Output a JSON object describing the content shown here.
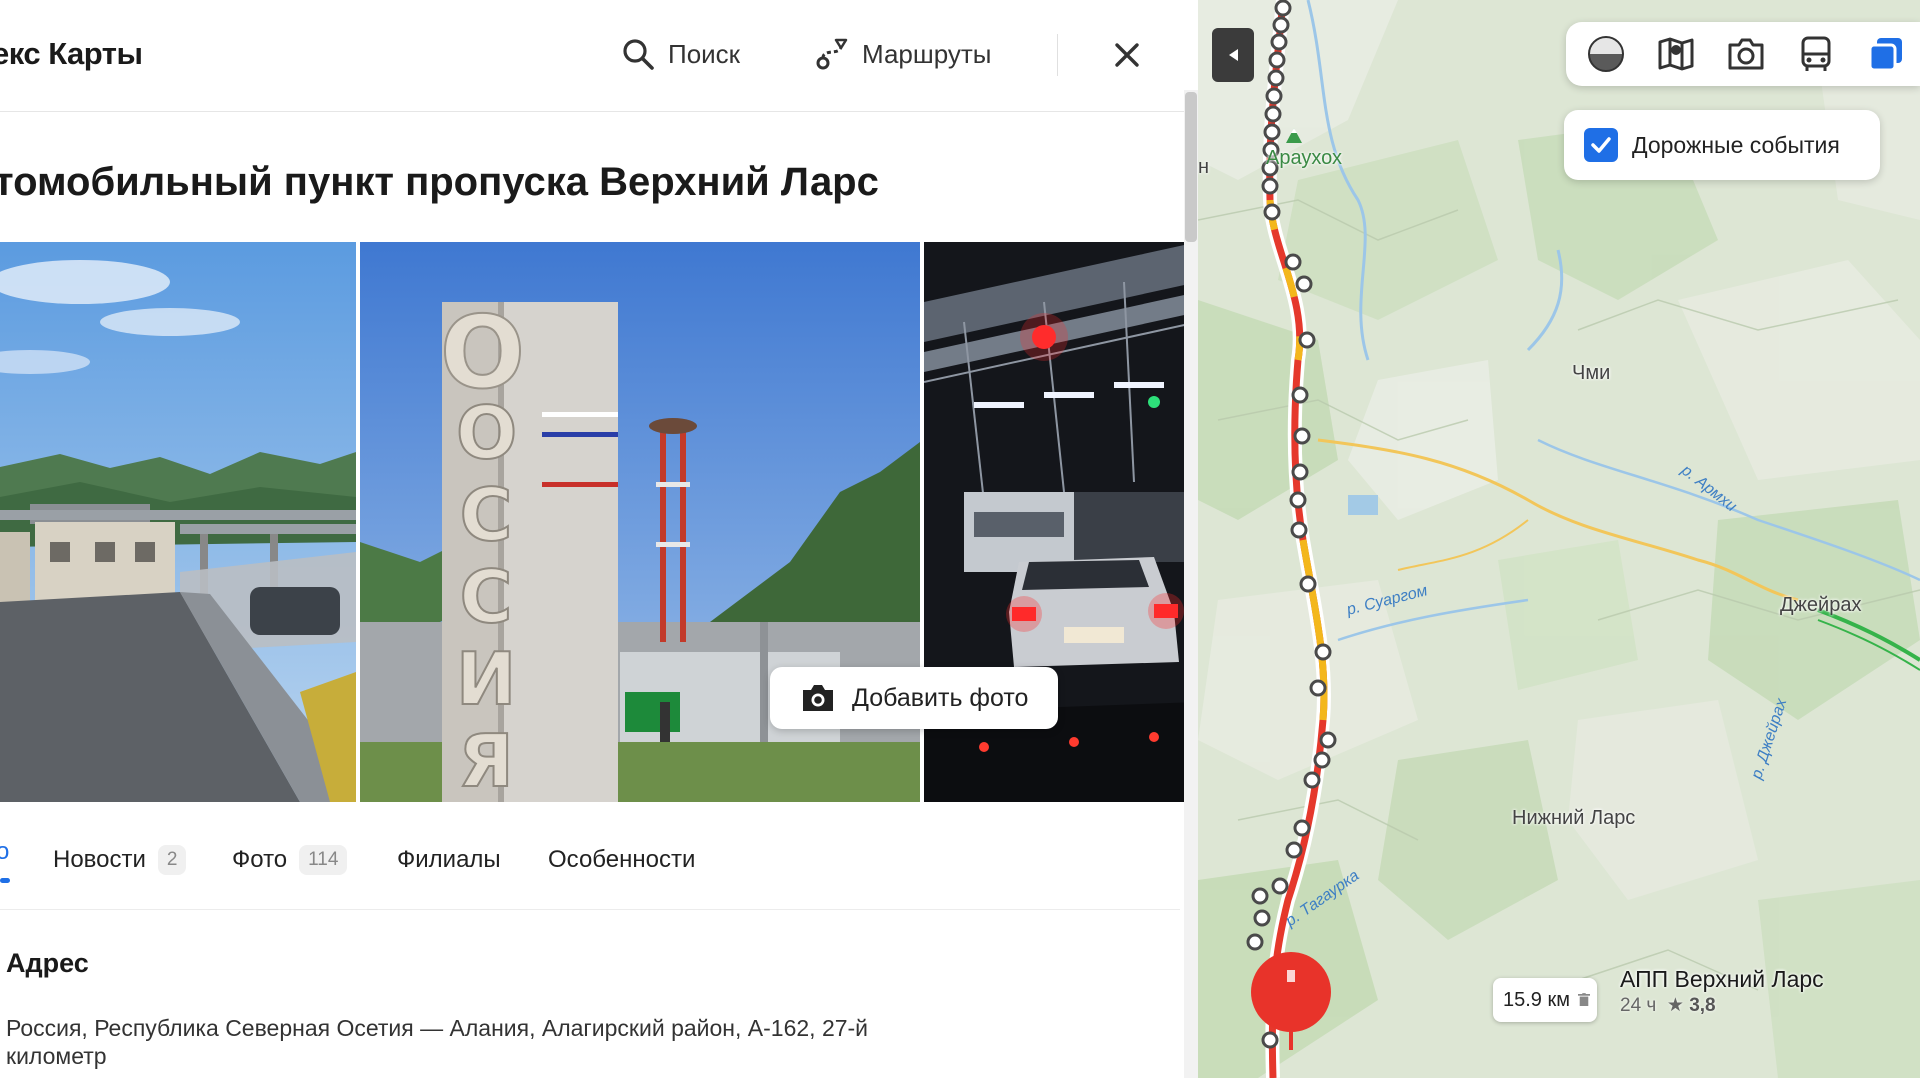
{
  "header": {
    "brand": "екс Карты",
    "search_label": "Поиск",
    "routes_label": "Маршруты"
  },
  "place": {
    "title": "томобильный пункт пропуска Верхний Ларс",
    "add_photo_label": "Добавить фото",
    "photo2_sign_text": "ОССИЯ"
  },
  "tabs": {
    "partial_label": "о",
    "items": [
      {
        "label": "Новости",
        "count": "2"
      },
      {
        "label": "Фото",
        "count": "114"
      },
      {
        "label": "Филиалы"
      },
      {
        "label": "Особенности"
      }
    ]
  },
  "address": {
    "heading": "Адрес",
    "text": "Россия, Республика Северная Осетия — Алания, Алагирский район, А-162, 27-й километр"
  },
  "map": {
    "events_label": "Дорожные события",
    "events_checked": true,
    "layer_icons": [
      "panorama-icon",
      "map-layers-icon",
      "camera-icon",
      "transit-icon",
      "layers-icon"
    ],
    "labels": {
      "araukhokh": "Араухох",
      "chmi": "Чми",
      "dzheyrakh": "Джейрах",
      "nizhniy_lars": "Нижний Ларс",
      "edge_letter": "н"
    },
    "rivers": {
      "armkhi": "р. Армхи",
      "suargom": "р. Суаргом",
      "dzheyrakh": "р. Джейрах",
      "tagaurka": "р. Тагаурка"
    },
    "poi": {
      "distance": "15.9 км",
      "name": "АПП Верхний Ларс",
      "hours": "24 ч",
      "rating": "3,8"
    },
    "colors": {
      "accent": "#1f6fe6",
      "poi_red": "#e8332a",
      "traffic_red": "#e5382c",
      "traffic_yellow": "#f3b71c",
      "road_green": "#35b34a"
    }
  }
}
